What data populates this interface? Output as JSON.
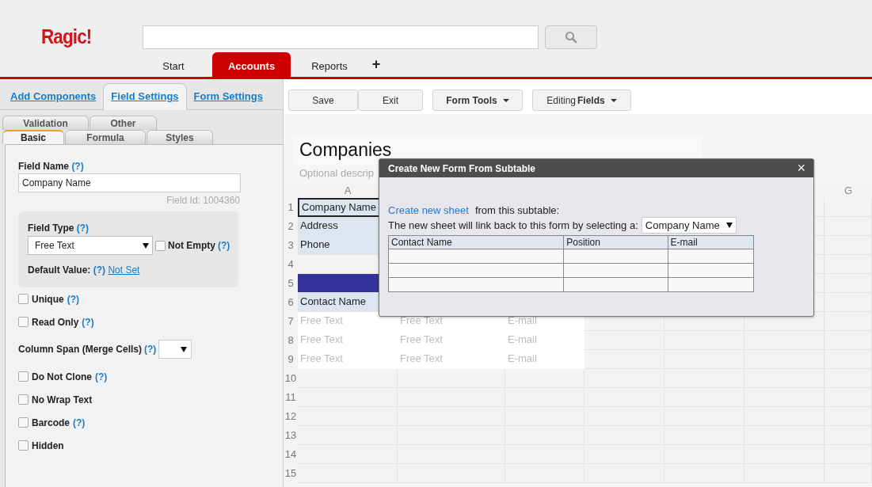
{
  "logo": "Ragic!",
  "tabs": [
    {
      "label": "Start",
      "kind": "text",
      "selected": false
    },
    {
      "label": "Accounts",
      "kind": "text",
      "selected": true
    },
    {
      "label": "Reports",
      "kind": "text",
      "selected": false
    },
    {
      "label": "+",
      "kind": "add",
      "selected": false
    }
  ],
  "panel_tabs": [
    {
      "label": "Add Components",
      "selected": false
    },
    {
      "label": "Field Settings",
      "selected": true
    },
    {
      "label": "Form Settings",
      "selected": false
    }
  ],
  "sub_tabs_back": [
    {
      "label": "Validation",
      "selected": false
    },
    {
      "label": "Other",
      "selected": false
    }
  ],
  "sub_tabs_front": [
    {
      "label": "Basic",
      "selected": true
    },
    {
      "label": "Formula",
      "selected": false
    },
    {
      "label": "Styles",
      "selected": false
    }
  ],
  "field_name": {
    "label": "Field Name",
    "help": "(?)",
    "value": "Company Name",
    "field_id": "Field Id: 1004360"
  },
  "field_type": {
    "label": "Field Type",
    "help": "(?)",
    "value": "Free Text",
    "not_empty": {
      "label": "Not Empty",
      "help": "(?)",
      "checked": false
    },
    "default_label": "Default Value:",
    "default_help": "(?)",
    "default_link": "Not Set"
  },
  "options": [
    {
      "kind": "checkbox",
      "label": "Unique",
      "help": "(?)",
      "checked": false
    },
    {
      "kind": "checkbox",
      "label": "Read Only",
      "help": "(?)",
      "checked": false
    },
    {
      "kind": "select",
      "label": "Column Span (Merge Cells)",
      "help": "(?)"
    },
    {
      "kind": "checkbox",
      "label": "Do Not Clone",
      "help": "(?)",
      "checked": false
    },
    {
      "kind": "checkbox",
      "label": "No Wrap Text",
      "checked": false
    },
    {
      "kind": "checkbox",
      "label": "Barcode",
      "help": "(?)",
      "checked": false
    },
    {
      "kind": "checkbox",
      "label": "Hidden",
      "checked": false
    }
  ],
  "toolbar": [
    {
      "label": "Save",
      "kind": "plain"
    },
    {
      "label": "Exit",
      "kind": "plain"
    },
    {
      "label": "Form Tools",
      "kind": "menu"
    },
    {
      "label": "Editing ",
      "bold": "Fields",
      "kind": "menu"
    }
  ],
  "sheet": {
    "title": "Companies",
    "description": "Optional descrip",
    "column_a_header": "A",
    "column_g_header": "G",
    "rows": [
      {
        "number": "1",
        "kind": "field",
        "cells": [
          "Company Name"
        ],
        "selected": true
      },
      {
        "number": "2",
        "kind": "field",
        "cells": [
          "Address"
        ],
        "selected": false
      },
      {
        "number": "3",
        "kind": "field",
        "cells": [
          "Phone"
        ],
        "selected": false
      },
      {
        "number": "4",
        "kind": "blank",
        "cells": [],
        "selected": false
      },
      {
        "number": "5",
        "kind": "band",
        "cells": [],
        "selected": false
      },
      {
        "number": "6",
        "kind": "field",
        "cells": [
          "Contact Name"
        ],
        "selected": false
      },
      {
        "number": "7",
        "kind": "entry",
        "cells": [
          "Free Text",
          "Free Text",
          "E-mail"
        ],
        "selected": false
      },
      {
        "number": "8",
        "kind": "entry",
        "cells": [
          "Free Text",
          "Free Text",
          "E-mail"
        ],
        "selected": false
      },
      {
        "number": "9",
        "kind": "entry",
        "cells": [
          "Free Text",
          "Free Text",
          "E-mail"
        ],
        "selected": false
      },
      {
        "number": "10",
        "kind": "blank",
        "cells": [],
        "selected": false
      },
      {
        "number": "11",
        "kind": "blank",
        "cells": [],
        "selected": false
      },
      {
        "number": "12",
        "kind": "blank",
        "cells": [],
        "selected": false
      },
      {
        "number": "13",
        "kind": "blank",
        "cells": [],
        "selected": false
      },
      {
        "number": "14",
        "kind": "blank",
        "cells": [],
        "selected": false
      },
      {
        "number": "15",
        "kind": "blank",
        "cells": [],
        "selected": false
      }
    ]
  },
  "dialog": {
    "title": "Create New Form From Subtable",
    "close": "×",
    "link": "Create new sheet",
    "link_rest": "from this subtable:",
    "prompt": "The new sheet will link back to this form by selecting a:",
    "select": "Company Name",
    "columns": [
      "Contact Name",
      "Position",
      "E-mail"
    ]
  }
}
